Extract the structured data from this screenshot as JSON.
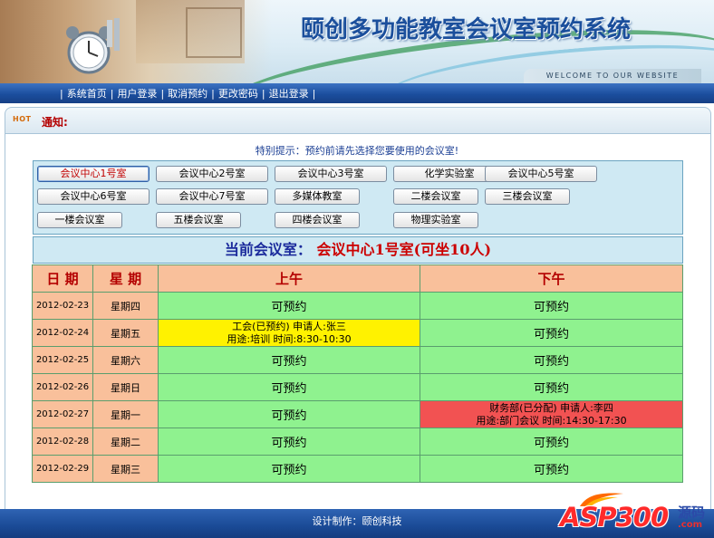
{
  "header": {
    "title": "颐创多功能教室会议室预约系统",
    "welcome": "WELCOME TO OUR WEBSITE"
  },
  "nav": {
    "separator": "|",
    "items": [
      "系统首页",
      "用户登录",
      "取消预约",
      "更改密码",
      "退出登录"
    ]
  },
  "notice": {
    "icon": "hot-icon",
    "icon_text": "HOT",
    "label": "通知:"
  },
  "hint": "特别提示：预约前请先选择您要使用的会议室!",
  "rooms": [
    "会议中心1号室",
    "会议中心2号室",
    "会议中心3号室",
    "化学实验室",
    "会议中心5号室",
    "会议中心6号室",
    "会议中心7号室",
    "多媒体教室",
    "二楼会议室",
    "三楼会议室",
    "一楼会议室",
    "五楼会议室",
    "四楼会议室",
    "物理实验室"
  ],
  "selected_room_index": 0,
  "current": {
    "label": "当前会议室：",
    "value": "会议中心1号室(可坐10人)"
  },
  "table": {
    "headers": {
      "date": "日 期",
      "week": "星 期",
      "am": "上午",
      "pm": "下午"
    },
    "rows": [
      {
        "date": "2012-02-23",
        "week": "星期四",
        "am": {
          "status": "free",
          "line1": "可预约"
        },
        "pm": {
          "status": "free",
          "line1": "可预约"
        }
      },
      {
        "date": "2012-02-24",
        "week": "星期五",
        "am": {
          "status": "booked",
          "line1": "工会(已预约) 申请人:张三",
          "line2": "用途:培训 时间:8:30-10:30"
        },
        "pm": {
          "status": "free",
          "line1": "可预约"
        }
      },
      {
        "date": "2012-02-25",
        "week": "星期六",
        "am": {
          "status": "free",
          "line1": "可预约"
        },
        "pm": {
          "status": "free",
          "line1": "可预约"
        }
      },
      {
        "date": "2012-02-26",
        "week": "星期日",
        "am": {
          "status": "free",
          "line1": "可预约"
        },
        "pm": {
          "status": "free",
          "line1": "可预约"
        }
      },
      {
        "date": "2012-02-27",
        "week": "星期一",
        "am": {
          "status": "free",
          "line1": "可预约"
        },
        "pm": {
          "status": "assigned",
          "line1": "财务部(已分配) 申请人:李四",
          "line2": "用途:部门会议 时间:14:30-17:30"
        }
      },
      {
        "date": "2012-02-28",
        "week": "星期二",
        "am": {
          "status": "free",
          "line1": "可预约"
        },
        "pm": {
          "status": "free",
          "line1": "可预约"
        }
      },
      {
        "date": "2012-02-29",
        "week": "星期三",
        "am": {
          "status": "free",
          "line1": "可预约"
        },
        "pm": {
          "status": "free",
          "line1": "可预约"
        }
      }
    ]
  },
  "footer": {
    "text": "设计制作：颐创科技",
    "logo": {
      "asp": "ASP300",
      "cn": "源码",
      "com": ".com"
    }
  },
  "colors": {
    "nav_bg": "#1b4e9e",
    "header_cell": "#f9c09b",
    "free": "#8ff28f",
    "booked": "#fff200",
    "assigned": "#f25252",
    "room_panel": "#cfe9f3"
  }
}
